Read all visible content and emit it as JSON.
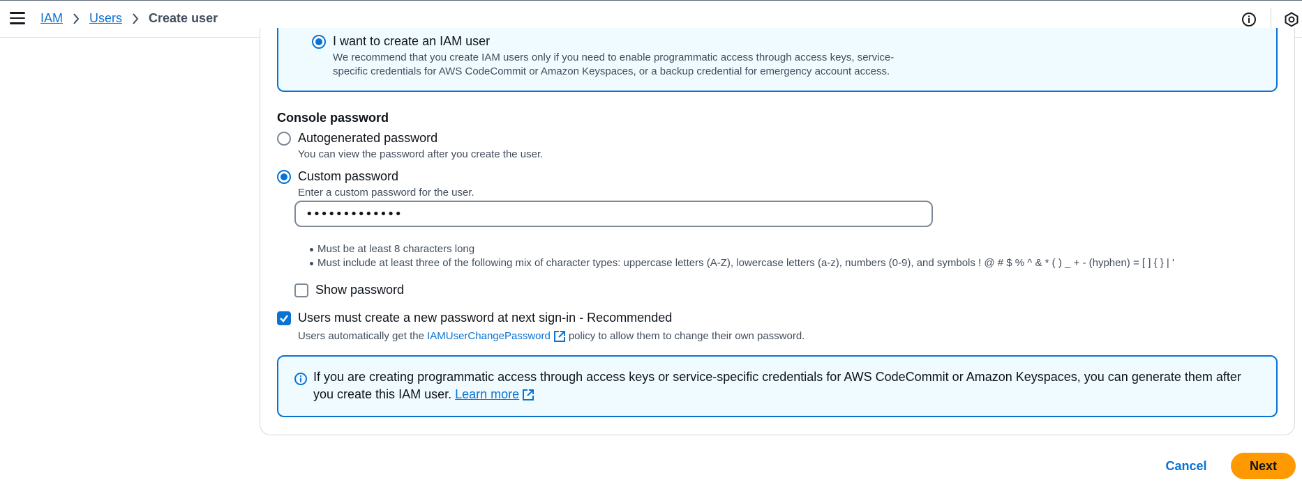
{
  "breadcrumb": {
    "items": [
      "IAM",
      "Users"
    ],
    "current": "Create user"
  },
  "iam_user_option": {
    "title": "I want to create an IAM user",
    "desc_line1": "We recommend that you create IAM users only if you need to enable programmatic access through access keys, service-",
    "desc_line2": "specific credentials for AWS CodeCommit or Amazon Keyspaces, or a backup credential for emergency account access."
  },
  "console_password": {
    "label": "Console password",
    "autogen_title": "Autogenerated password",
    "autogen_desc": "You can view the password after you create the user.",
    "custom_title": "Custom password",
    "custom_desc": "Enter a custom password for the user.",
    "password_value": "•••••••••••••",
    "selected": "custom",
    "rules": [
      "Must be at least 8 characters long",
      "Must include at least three of the following mix of character types: uppercase letters (A-Z), lowercase letters (a-z), numbers (0-9), and symbols ! @ # $ % ^ & * ( ) _ + - (hyphen) = [ ] { } | '"
    ],
    "show_password_label": "Show password",
    "show_password_checked": false
  },
  "reset_option": {
    "label": "Users must create a new password at next sign-in - Recommended",
    "checked": true,
    "desc_prefix": "Users automatically get the",
    "desc_link": "IAMUserChangePassword",
    "desc_suffix": "policy to allow them to change their own password."
  },
  "info_alert": {
    "text": "If you are creating programmatic access through access keys or service-specific credentials for AWS CodeCommit or Amazon Keyspaces, you can generate them after you create this IAM user.",
    "link": "Learn more"
  },
  "actions": {
    "cancel": "Cancel",
    "next": "Next"
  },
  "colors": {
    "accent": "#0972d3",
    "primary_button": "#ff9900",
    "info_bg": "#f0fbff"
  }
}
